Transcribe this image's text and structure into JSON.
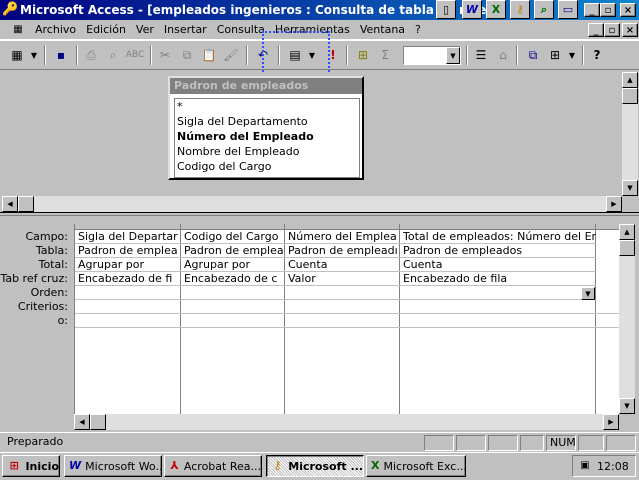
{
  "window": {
    "title": "Microsoft Access - [empleados ingenieros : Consulta de tabla de refe"
  },
  "menu": [
    "Archivo",
    "Edición",
    "Ver",
    "Insertar",
    "Consulta",
    "Herramientas",
    "Ventana",
    "?"
  ],
  "field_table": {
    "title": "Padron de empleados",
    "fields": [
      {
        "name": "*",
        "bold": false
      },
      {
        "name": "Sigla del Departamento",
        "bold": false
      },
      {
        "name": "Número del Empleado",
        "bold": true
      },
      {
        "name": "Nombre del Empleado",
        "bold": false
      },
      {
        "name": "Codigo del Cargo",
        "bold": false
      }
    ]
  },
  "grid": {
    "row_labels": [
      "Campo:",
      "Tabla:",
      "Total:",
      "Tab ref cruz:",
      "Orden:",
      "Criterios:",
      "o:"
    ],
    "columns": [
      {
        "campo": "Sigla del Departar",
        "tabla": "Padron de emplea",
        "total": "Agrupar por",
        "tabref": "Encabezado de fi"
      },
      {
        "campo": "Codigo del Cargo",
        "tabla": "Padron de emplea",
        "total": "Agrupar por",
        "tabref": "Encabezado de c"
      },
      {
        "campo": "Número del Emplea",
        "tabla": "Padron de empleadı",
        "total": "Cuenta",
        "tabref": "Valor"
      },
      {
        "campo": "Total de empleados: Número del Emp",
        "tabla": "Padron de empleados",
        "total": "Cuenta",
        "tabref": "Encabezado de fila"
      }
    ]
  },
  "status": {
    "text": "Preparado",
    "num": "NUM"
  },
  "taskbar": {
    "start": "Inicio",
    "items": [
      "Microsoft Wo...",
      "Acrobat Rea...",
      "Microsoft ...",
      "Microsoft Exc..."
    ],
    "clock": "12:08"
  },
  "colors": {
    "title_start": "#000080",
    "title_end": "#1084d0",
    "face": "#c0c0c0"
  }
}
